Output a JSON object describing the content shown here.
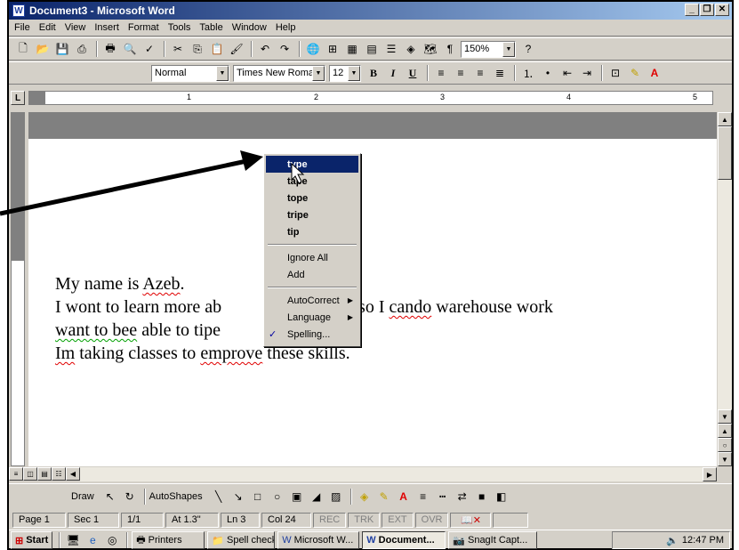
{
  "window": {
    "title": "Document3 - Microsoft Word"
  },
  "menu": [
    "File",
    "Edit",
    "View",
    "Insert",
    "Format",
    "Tools",
    "Table",
    "Window",
    "Help"
  ],
  "toolbar": {
    "zoom": "150%"
  },
  "format_bar": {
    "style": "Normal",
    "font": "Times New Roman",
    "size": "12",
    "bold": "B",
    "italic": "I",
    "underline": "U"
  },
  "ruler": {
    "marks": [
      "1",
      "2",
      "3",
      "4",
      "5"
    ]
  },
  "document": {
    "line1_a": "My name is ",
    "line1_b": "Azeb",
    "line1_c": ".",
    "line2_a": "I wont to learn more ab",
    "line2_b": "ters so I ",
    "line2_c": "cando",
    "line2_d": " warehouse work",
    "line3_a": "want to bee",
    "line3_b": " able to ti",
    "line3_c": "pe",
    "line4_a": "Im",
    "line4_b": " taking classes to ",
    "line4_c": "emprove",
    "line4_d": " these skills."
  },
  "context_menu": {
    "suggestions": [
      "type",
      "tape",
      "tope",
      "tripe",
      "tip"
    ],
    "ignore_all": "Ignore All",
    "add": "Add",
    "autocorrect": "AutoCorrect",
    "language": "Language",
    "spelling": "Spelling..."
  },
  "drawbar": {
    "draw": "Draw",
    "autoshapes": "AutoShapes"
  },
  "status": {
    "page": "Page 1",
    "sec": "Sec 1",
    "pages": "1/1",
    "at": "At 1.3\"",
    "ln": "Ln 3",
    "col": "Col 24",
    "rec": "REC",
    "trk": "TRK",
    "ext": "EXT",
    "ovr": "OVR"
  },
  "taskbar": {
    "start": "Start",
    "tasks": [
      "Printers",
      "Spell check",
      "Microsoft W...",
      "Document...",
      "SnagIt Capt..."
    ],
    "clock": "12:47 PM"
  },
  "colors": {
    "title_active": "#0a246a",
    "highlight": "#0a246a",
    "spell_error": "#e00000",
    "grammar_error": "#00a000",
    "chrome": "#d4d0c8"
  }
}
